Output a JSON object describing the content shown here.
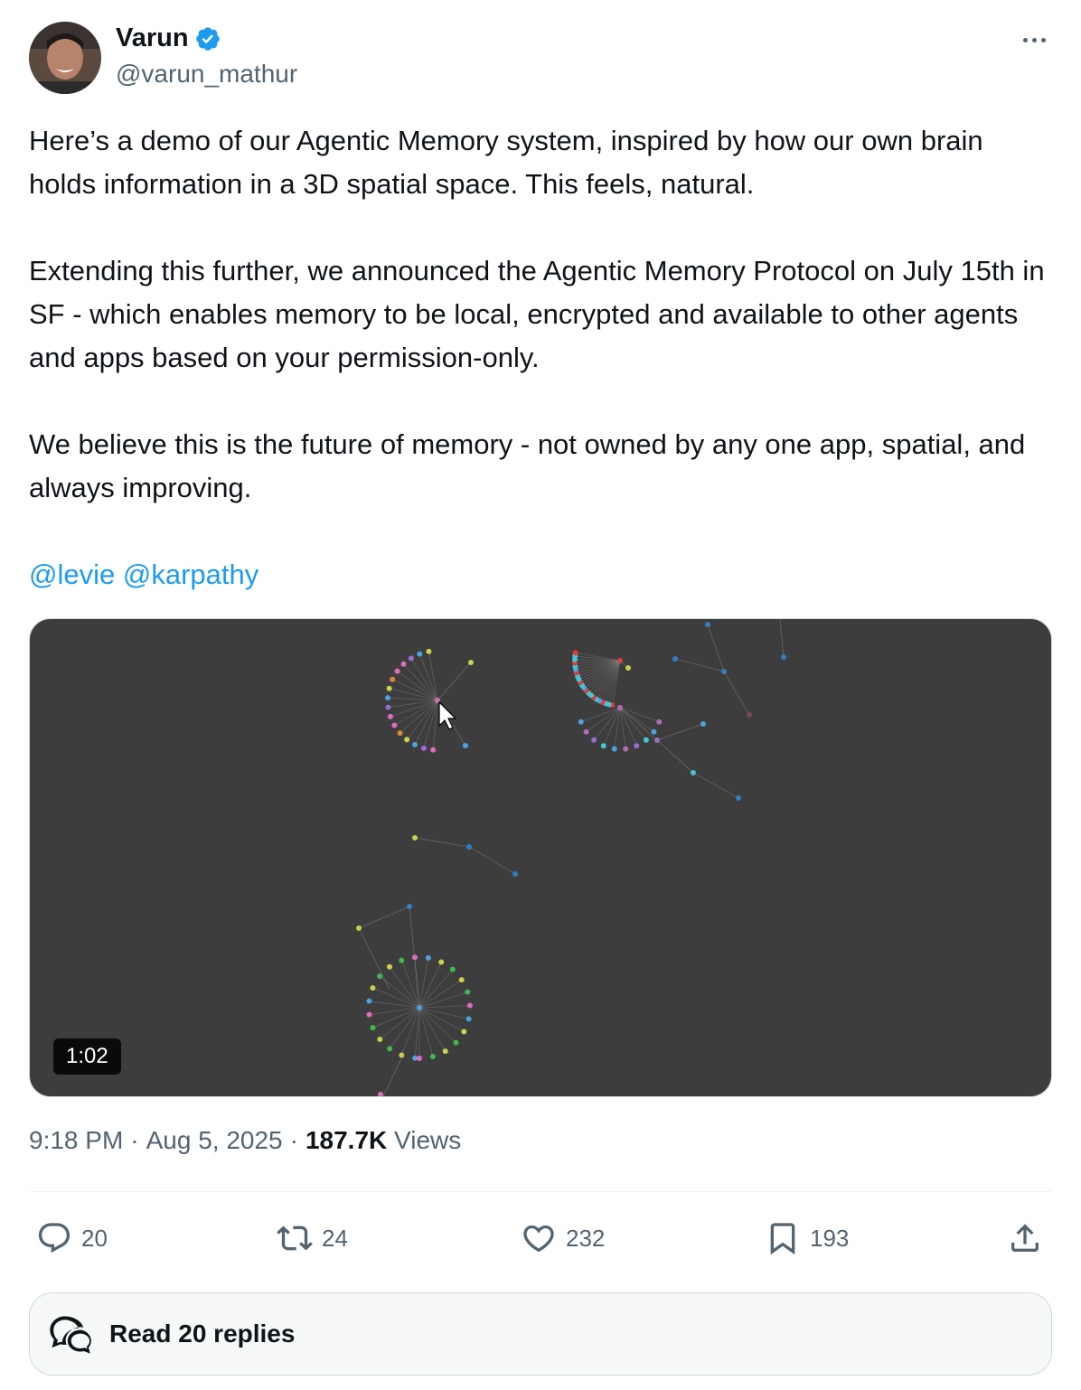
{
  "author": {
    "name": "Varun",
    "handle": "@varun_mathur",
    "verified": true
  },
  "tweet": {
    "paragraphs": [
      "Here’s a demo of our Agentic Memory system, inspired by how our own brain holds information in a 3D spatial space. This feels, natural.",
      "Extending this further, we announced the Agentic Memory Protocol on July 15th in SF - which enables memory to be local, encrypted and available to other agents and apps based on your permission-only.",
      "We believe this is the future of memory - not owned by any one app, spatial, and always improving."
    ],
    "mentions": [
      "@levie",
      "@karpathy"
    ]
  },
  "media": {
    "type": "video",
    "duration": "1:02"
  },
  "meta": {
    "time": "9:18 PM",
    "separator": "·",
    "date": "Aug 5, 2025",
    "views_count": "187.7K",
    "views_label": "Views"
  },
  "actions": {
    "replies": "20",
    "reposts": "24",
    "likes": "232",
    "bookmarks": "193"
  },
  "read_replies": {
    "label": "Read 20 replies"
  },
  "colors": {
    "accent": "#1d9bf0",
    "secondary_text": "#536471",
    "video_bg": "#3d3d3d"
  }
}
